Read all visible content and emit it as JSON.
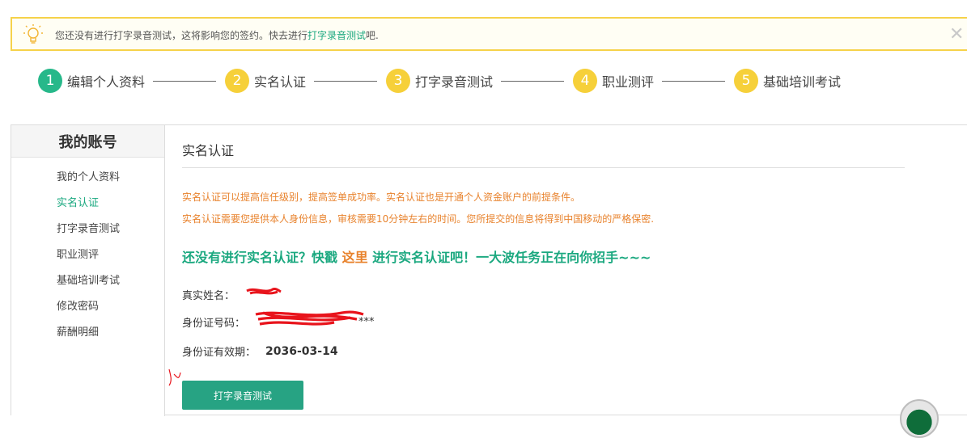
{
  "notice": {
    "text_prefix": "您还没有进行打字录音测试，这将影响您的签约。快去进行",
    "link": "打字录音测试",
    "text_suffix": "吧.",
    "close_icon": "close-icon",
    "bulb_icon": "lightbulb-icon"
  },
  "steps": [
    {
      "num": "1",
      "label": "编辑个人资料",
      "state": "active"
    },
    {
      "num": "2",
      "label": "实名认证",
      "state": "todo"
    },
    {
      "num": "3",
      "label": "打字录音测试",
      "state": "todo"
    },
    {
      "num": "4",
      "label": "职业测评",
      "state": "todo"
    },
    {
      "num": "5",
      "label": "基础培训考试",
      "state": "todo"
    }
  ],
  "sidebar": {
    "title": "我的账号",
    "items": [
      {
        "label": "我的个人资料"
      },
      {
        "label": "实名认证"
      },
      {
        "label": "打字录音测试"
      },
      {
        "label": "职业测评"
      },
      {
        "label": "基础培训考试"
      },
      {
        "label": "修改密码"
      },
      {
        "label": "薪酬明细"
      }
    ]
  },
  "content": {
    "title": "实名认证",
    "hint1": "实名认证可以提高信任级别，提高签单成功率。实名认证也是开通个人资金账户的前提条件。",
    "hint2": "实名认证需要您提供本人身份信息，审核需要10分钟左右的时间。您所提交的信息将得到中国移动的严格保密.",
    "cta_prefix": "还没有进行实名认证？快戳 ",
    "cta_link": "这里",
    "cta_suffix": " 进行实名认证吧！一大波任务正在向你招手~~~",
    "fields": {
      "name_label": "真实姓名：",
      "id_label": "身份证号码：",
      "id_tail": "***",
      "expiry_label": "身份证有效期：",
      "expiry_value": "2036-03-14"
    },
    "button_label": "打字录音测试"
  },
  "colors": {
    "accent_green": "#1aa87f",
    "step_yellow": "#f6d03a",
    "hint_orange": "#e8822c",
    "notice_border": "#f6d24a"
  }
}
